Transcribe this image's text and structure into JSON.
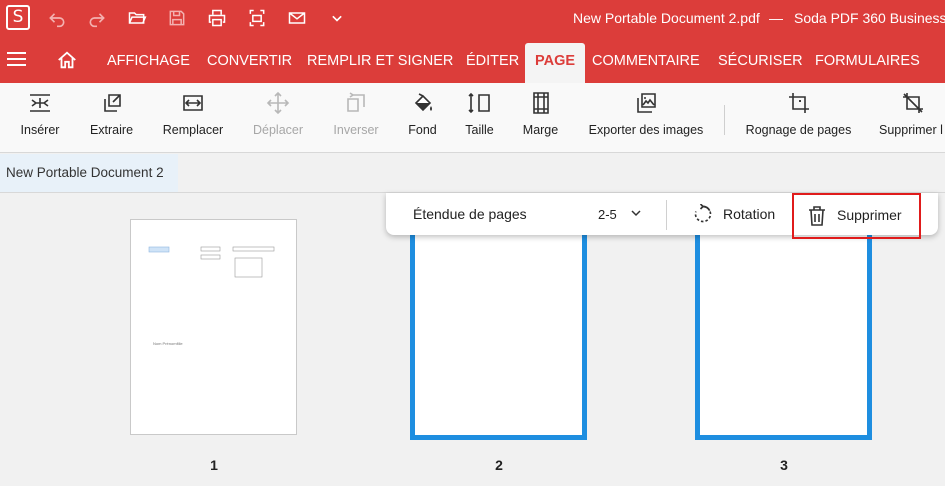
{
  "app": {
    "logo_letter": "S",
    "document_title": "New Portable Document 2.pdf",
    "title_separator": "—",
    "product_name": "Soda PDF 360 Business"
  },
  "quick_access": [
    {
      "name": "undo-icon"
    },
    {
      "name": "redo-icon"
    },
    {
      "name": "open-folder-icon"
    },
    {
      "name": "save-icon"
    },
    {
      "name": "print-icon"
    },
    {
      "name": "scan-icon"
    },
    {
      "name": "mail-icon"
    },
    {
      "name": "chevron-down-icon"
    }
  ],
  "menu": {
    "tabs": [
      {
        "label": "AFFICHAGE"
      },
      {
        "label": "CONVERTIR"
      },
      {
        "label": "REMPLIR ET SIGNER"
      },
      {
        "label": "ÉDITER"
      },
      {
        "label": "PAGE",
        "active": true
      },
      {
        "label": "COMMENTAIRE"
      },
      {
        "label": "SÉCURISER"
      },
      {
        "label": "FORMULAIRES"
      }
    ]
  },
  "ribbon": {
    "buttons": [
      {
        "label": "Insérer",
        "icon": "insert-page-icon",
        "enabled": true
      },
      {
        "label": "Extraire",
        "icon": "extract-page-icon",
        "enabled": true
      },
      {
        "label": "Remplacer",
        "icon": "replace-page-icon",
        "enabled": true
      },
      {
        "label": "Déplacer",
        "icon": "move-page-icon",
        "enabled": false
      },
      {
        "label": "Inverser",
        "icon": "reverse-pages-icon",
        "enabled": false
      },
      {
        "label": "Fond",
        "icon": "paint-bucket-icon",
        "enabled": true
      },
      {
        "label": "Taille",
        "icon": "page-size-icon",
        "enabled": true
      },
      {
        "label": "Marge",
        "icon": "page-margin-icon",
        "enabled": true
      },
      {
        "label": "Exporter des images",
        "icon": "export-images-icon",
        "enabled": true
      },
      {
        "label": "Rognage de pages",
        "icon": "crop-icon",
        "enabled": true
      },
      {
        "label": "Supprimer l",
        "icon": "delete-crop-icon",
        "enabled": true
      }
    ]
  },
  "document_tab": {
    "label": "New Portable Document 2"
  },
  "page_toolbar": {
    "range_label": "Étendue de pages",
    "range_value": "2-5",
    "rotation_label": "Rotation",
    "delete_label": "Supprimer"
  },
  "pages": [
    {
      "number": "1",
      "selected": false,
      "thumb_text": "Nom Prénomfille"
    },
    {
      "number": "2",
      "selected": true
    },
    {
      "number": "3",
      "selected": true
    }
  ],
  "colors": {
    "brand_red": "#dc3d3a",
    "selection_blue": "#1e8ee0",
    "highlight_red": "#e01b1b"
  }
}
